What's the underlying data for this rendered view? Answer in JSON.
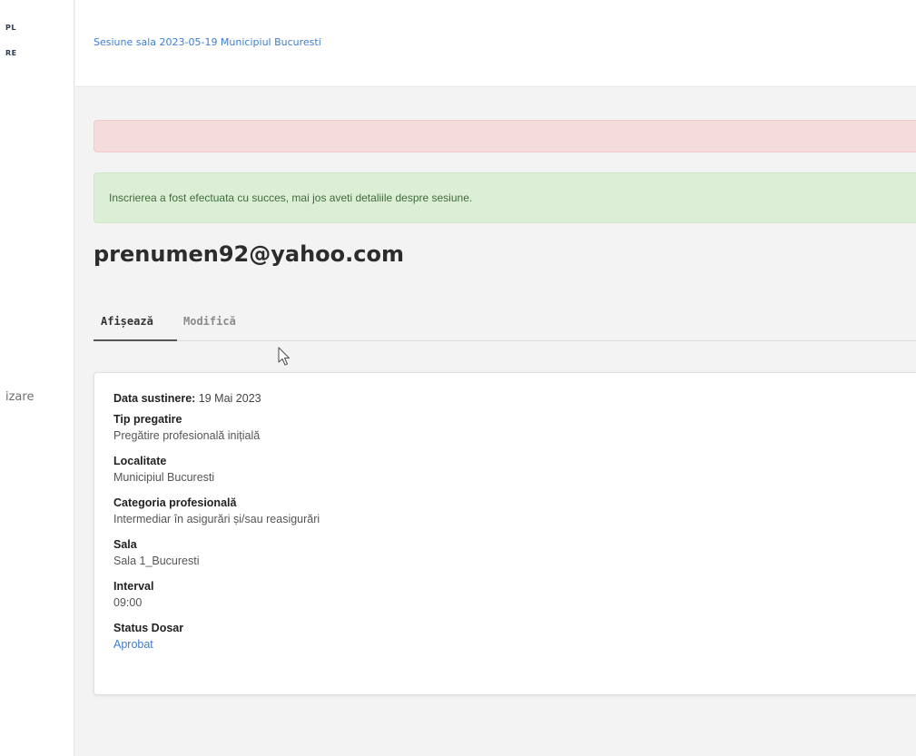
{
  "sidebar": {
    "logo_line1": "PL",
    "logo_line2": "RE",
    "item_label": "izare"
  },
  "header": {
    "breadcrumb": "Sesiune sala 2023-05-19 Municipiul Bucuresti"
  },
  "alerts": {
    "error_text": "",
    "success_text": "Inscrierea a fost efectuata cu succes, mai jos aveti detaliile despre sesiune."
  },
  "page": {
    "title": "prenumen92@yahoo.com"
  },
  "tabs": [
    {
      "label": "Afișează",
      "active": true
    },
    {
      "label": "Modifică",
      "active": false
    }
  ],
  "details": {
    "data_sustinere_label": "Data sustinere:",
    "data_sustinere_value": "19 Mai 2023",
    "fields": [
      {
        "label": "Tip pregatire",
        "value": "Pregătire profesională inițială"
      },
      {
        "label": "Localitate",
        "value": "Municipiul Bucuresti"
      },
      {
        "label": "Categoria profesională",
        "value": "Intermediar în asigurări și/sau reasigurări"
      },
      {
        "label": "Sala",
        "value": "Sala 1_Bucuresti"
      },
      {
        "label": "Interval",
        "value": "09:00"
      },
      {
        "label": "Status Dosar",
        "value": "Aprobat"
      }
    ]
  },
  "colors": {
    "link": "#3d7dd6",
    "error_bg": "#f5dcdc",
    "success_bg": "#dcefd6",
    "success_text": "#3e6b3a"
  },
  "icons": {
    "cursor": "mouse-pointer-icon"
  }
}
